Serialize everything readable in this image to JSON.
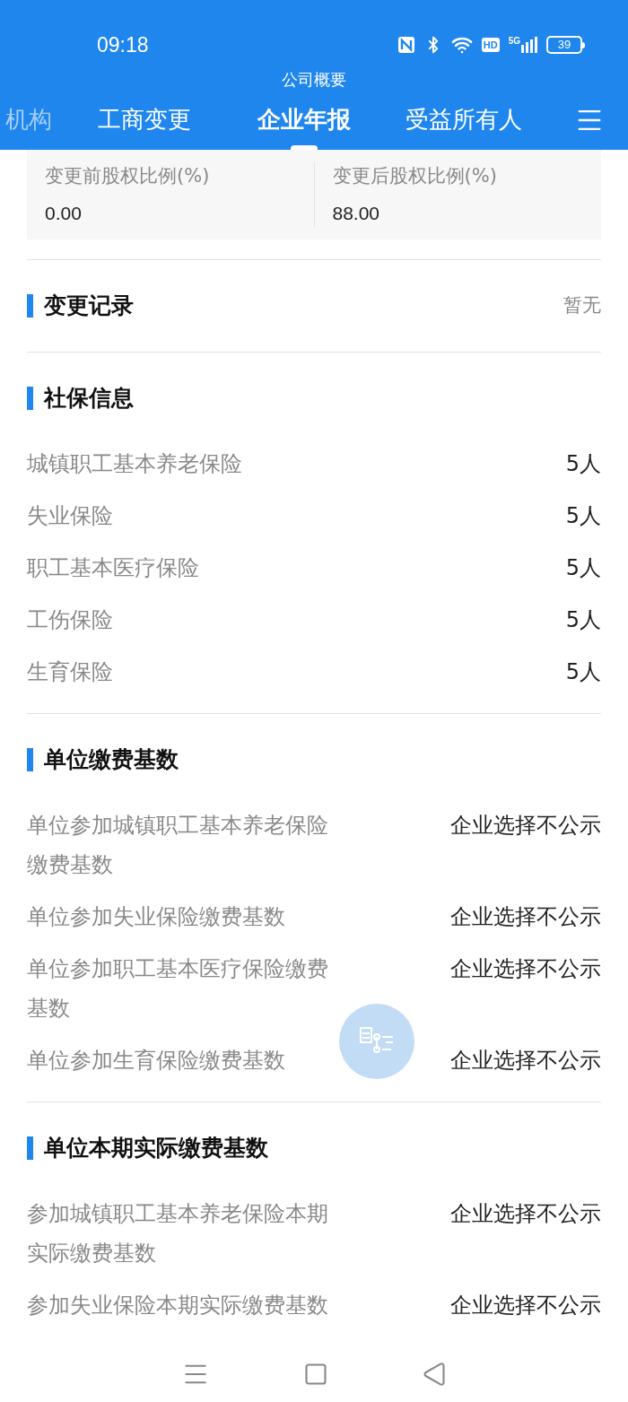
{
  "status_bar": {
    "time": "09:18",
    "hd": "HD",
    "network": "5G",
    "battery": "39"
  },
  "header": {
    "title": "公司概要"
  },
  "tabs": [
    {
      "label": "机构",
      "selected": false
    },
    {
      "label": "工商变更",
      "selected": false
    },
    {
      "label": "企业年报",
      "selected": true
    },
    {
      "label": "受益所有人",
      "selected": false
    }
  ],
  "equity_card": {
    "fields": [
      {
        "label": "变更前股权比例(%)",
        "value": "0.00"
      },
      {
        "label": "变更后股权比例(%)",
        "value": "88.00"
      }
    ]
  },
  "sections": [
    {
      "title": "变更记录",
      "value": "暂无"
    },
    {
      "title": "社保信息",
      "rows": [
        {
          "label": "城镇职工基本养老保险",
          "value": "5人"
        },
        {
          "label": "失业保险",
          "value": "5人"
        },
        {
          "label": "职工基本医疗保险",
          "value": "5人"
        },
        {
          "label": "工伤保险",
          "value": "5人"
        },
        {
          "label": "生育保险",
          "value": "5人"
        }
      ]
    },
    {
      "title": "单位缴费基数",
      "rows": [
        {
          "label": "单位参加城镇职工基本养老保险缴费基数",
          "value": "企业选择不公示"
        },
        {
          "label": "单位参加失业保险缴费基数",
          "value": "企业选择不公示"
        },
        {
          "label": "单位参加职工基本医疗保险缴费基数",
          "value": "企业选择不公示"
        },
        {
          "label": "单位参加生育保险缴费基数",
          "value": "企业选择不公示"
        }
      ]
    },
    {
      "title": "单位本期实际缴费基数",
      "rows": [
        {
          "label": "参加城镇职工基本养老保险本期实际缴费基数",
          "value": "企业选择不公示"
        },
        {
          "label": "参加失业保险本期实际缴费基数",
          "value": "企业选择不公示"
        }
      ]
    }
  ]
}
